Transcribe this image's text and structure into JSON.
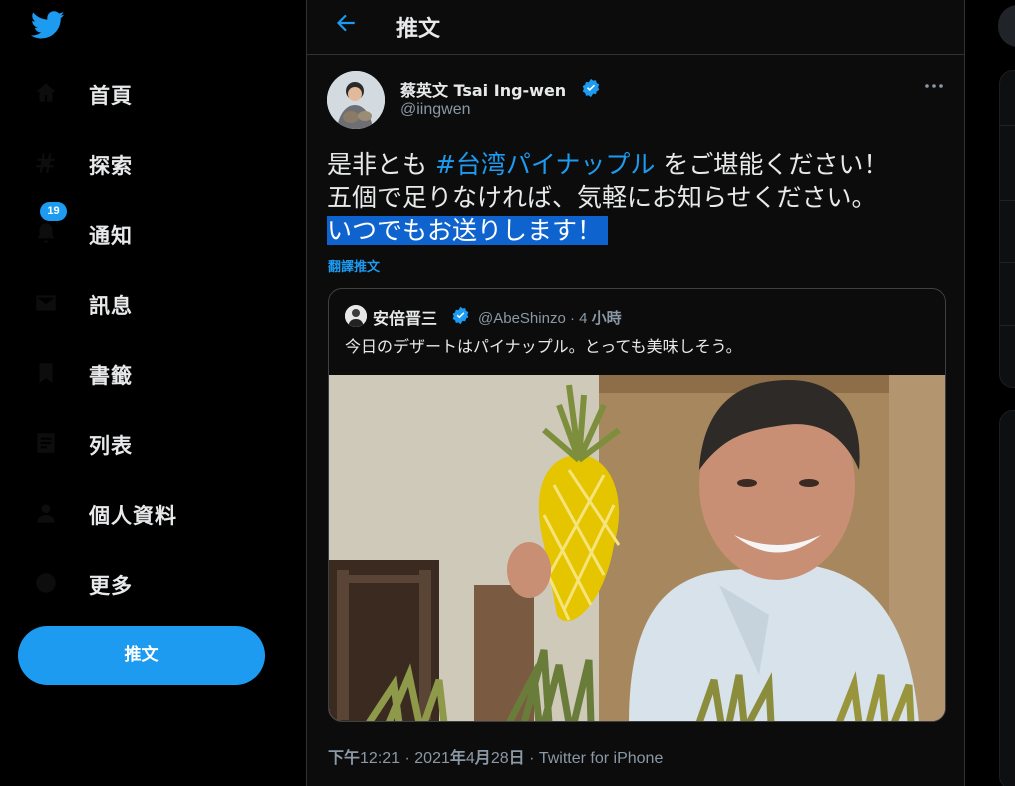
{
  "sidebar": {
    "items": [
      {
        "label": "首頁",
        "icon": "home-icon"
      },
      {
        "label": "探索",
        "icon": "hashtag-icon"
      },
      {
        "label": "通知",
        "icon": "bell-icon",
        "badge": "19"
      },
      {
        "label": "訊息",
        "icon": "mail-icon"
      },
      {
        "label": "書籤",
        "icon": "bookmark-icon"
      },
      {
        "label": "列表",
        "icon": "list-icon"
      },
      {
        "label": "個人資料",
        "icon": "person-icon"
      },
      {
        "label": "更多",
        "icon": "more-circle-icon"
      }
    ],
    "tweet_button": "推文"
  },
  "header": {
    "title": "推文"
  },
  "tweet": {
    "author_name": "蔡英文 Tsai Ing-wen",
    "author_handle": "@iingwen",
    "text_line1_before": "是非とも ",
    "text_line1_hashtag": "#台湾パイナップル",
    "text_line1_after": " をご堪能ください！",
    "text_line2": "五個で足りなければ、気軽にお知らせください。",
    "text_line3": "いつでもお送りします！",
    "translate_label": "翻譯推文",
    "meta_time": "下午",
    "meta_clock": "12:21",
    "meta_sep1": " · ",
    "meta_date_year": "2021",
    "meta_date_y": "年",
    "meta_date_m_num": "4",
    "meta_date_m": "月",
    "meta_date_d_num": "28",
    "meta_date_d": "日",
    "meta_sep2": " · ",
    "meta_source": "Twitter for iPhone"
  },
  "quote": {
    "name": "安倍晋三",
    "handle": "@AbeShinzo",
    "dot": " · ",
    "time_num": "4 ",
    "time_unit": "小時",
    "text": "今日のデザートはパイナップル。とっても美味しそう。"
  },
  "colors": {
    "accent": "#1d9bf0",
    "background": "#000000",
    "text": "#e7e9ea",
    "muted": "#8b98a5"
  }
}
